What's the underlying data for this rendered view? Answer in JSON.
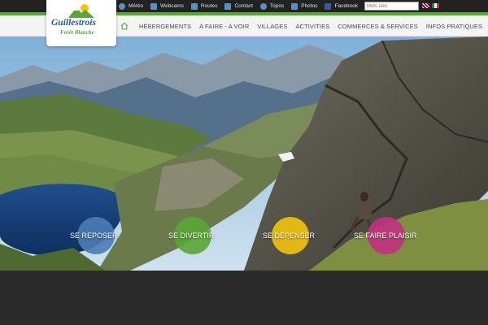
{
  "logo": {
    "name": "Guillestrois",
    "sub": "Forêt Blanche"
  },
  "toplinks": [
    {
      "label": "Météo",
      "icon": "weather-icon"
    },
    {
      "label": "Webcams",
      "icon": "webcam-icon"
    },
    {
      "label": "Routes",
      "icon": "road-icon"
    },
    {
      "label": "Contact",
      "icon": "mail-icon"
    },
    {
      "label": "Topos",
      "icon": "map-pin-icon"
    },
    {
      "label": "Photos",
      "icon": "photo-icon"
    },
    {
      "label": "Facebook",
      "icon": "facebook-icon"
    }
  ],
  "search": {
    "placeholder": "Mots clés"
  },
  "languages": [
    "en",
    "it"
  ],
  "nav": {
    "home_icon": "home-icon",
    "items": [
      "HÉBERGEMENTS",
      "A FAIRE - A VOIR",
      "VILLAGES",
      "ACTIVITIES",
      "COMMERCES & SERVICES",
      "INFOS PRATIQUES"
    ]
  },
  "circles": [
    {
      "label": "SE REPOSER",
      "color": "#4a7cb3"
    },
    {
      "label": "SE DIVERTIR",
      "color": "#5aa637"
    },
    {
      "label": "SE DÉPENSER",
      "color": "#f2c40c"
    },
    {
      "label": "SE FAIRE PLAISIR",
      "color": "#c2327e"
    }
  ],
  "colors": {
    "brand_green": "#5aa637",
    "brand_blue": "#1f5c8a",
    "nav_text": "#3d4c5a"
  }
}
